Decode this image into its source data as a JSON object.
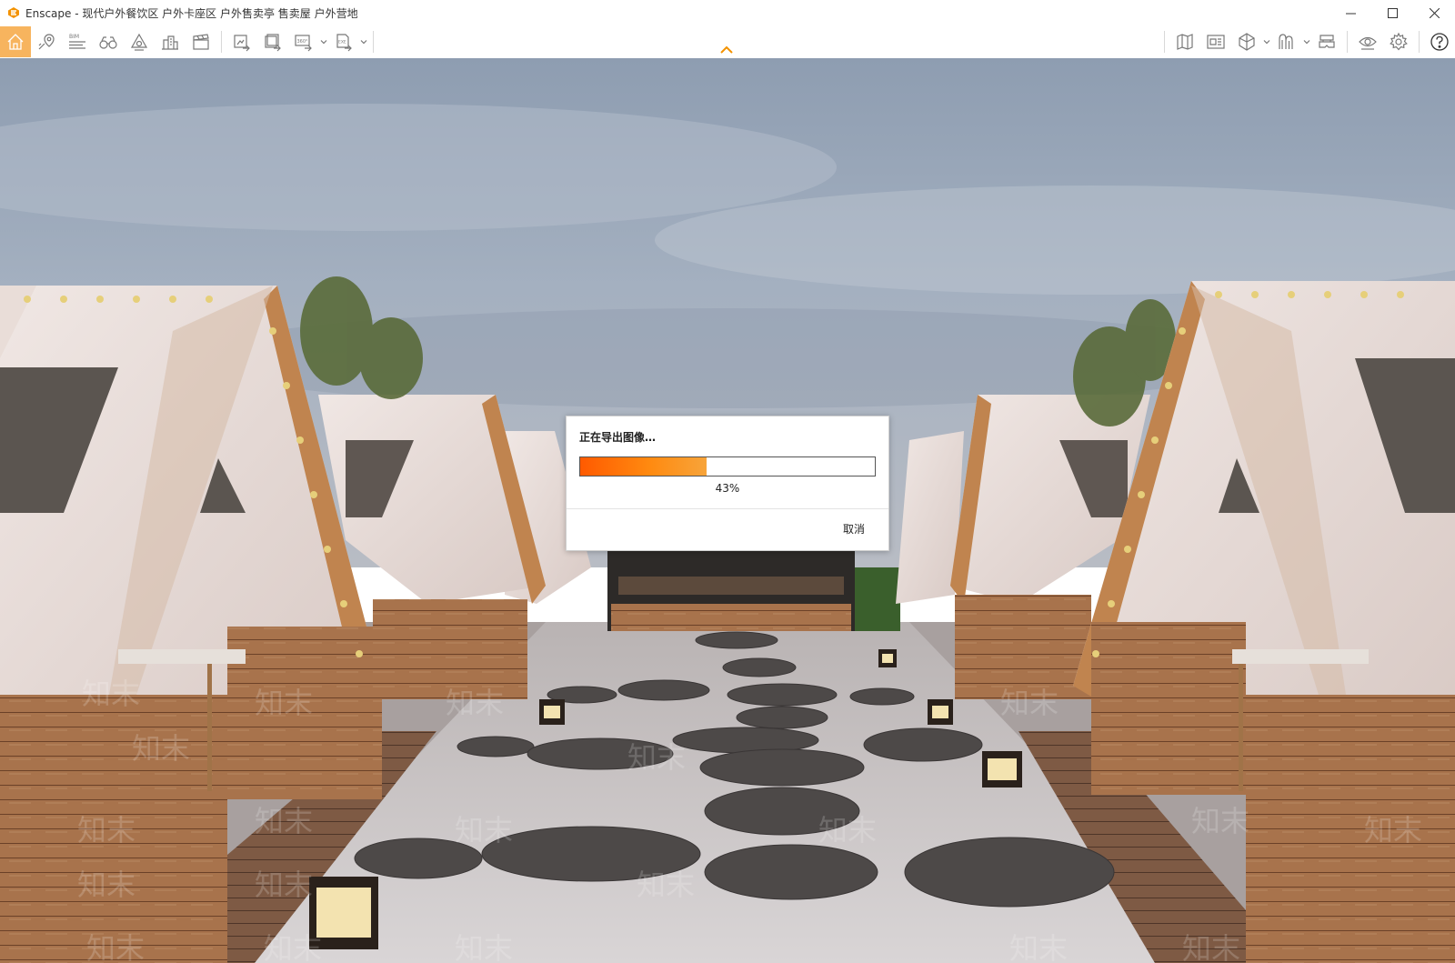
{
  "window": {
    "title": "Enscape - 现代户外餐饮区 户外卡座区 户外售卖亭 售卖屋 户外营地"
  },
  "colors": {
    "accent": "#f7b45e",
    "progress_start": "#ff5a00",
    "progress_end": "#f7a43a"
  },
  "toolbar": {
    "left_icons": [
      "home-icon",
      "location-pin-icon",
      "bim-list-icon",
      "binoculars-icon",
      "sun-lamp-icon",
      "buildings-icon",
      "clapperboard-icon",
      "screenshot-export-icon",
      "batch-export-icon",
      "panorama-360-export-icon",
      "exe-export-icon"
    ],
    "right_icons": [
      "map-icon",
      "minimap-icon",
      "cube-view-icon",
      "material-editor-icon",
      "vr-headset-icon",
      "visual-settings-eye-icon",
      "settings-gear-icon",
      "help-icon"
    ],
    "bim_label": "BIM",
    "panorama_label": "360°",
    "exe_label": "EXE"
  },
  "dialog": {
    "title": "正在导出图像…",
    "progress_value": 43,
    "progress_text": "43%",
    "cancel_label": "取消"
  },
  "watermark": {
    "text": "知末"
  }
}
